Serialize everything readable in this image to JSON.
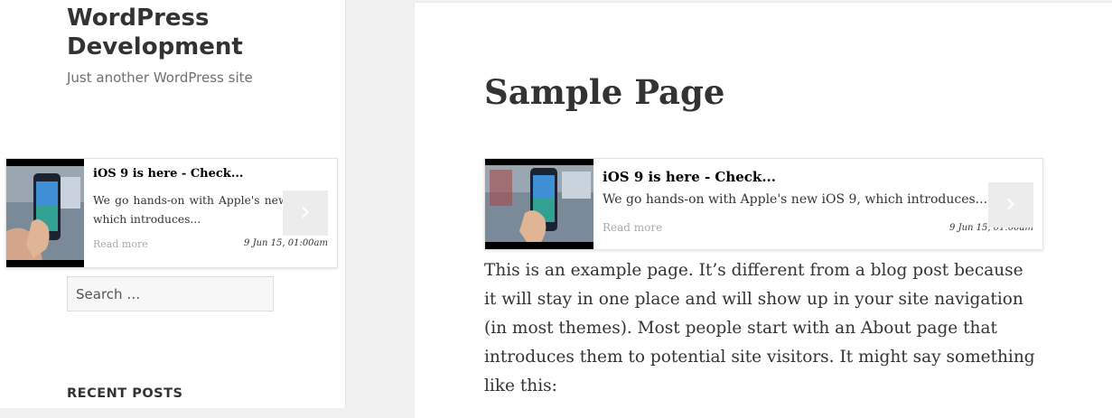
{
  "site": {
    "title": "WordPress Development",
    "description": "Just another WordPress site"
  },
  "related_card": {
    "title": "iOS 9 is here - Check...",
    "excerpt": "We go hands-on with Apple's new iOS 9, which introduces...",
    "read_more": "Read more",
    "date": "9 Jun 15, 01:00am",
    "next_glyph": "›"
  },
  "search": {
    "placeholder": "Search …"
  },
  "widgets": {
    "recent_posts_title": "RECENT POSTS"
  },
  "page": {
    "title": "Sample Page",
    "content": "This is an example page. It’s different from a blog post because it will stay in one place and will show up in your site navigation (in most themes). Most people start with an About page that introduces them to potential site visitors. It might say something like this:"
  },
  "colors": {
    "background": "#f1f1f1",
    "text": "#333333",
    "muted": "#707070",
    "next_button": "#ececec"
  }
}
